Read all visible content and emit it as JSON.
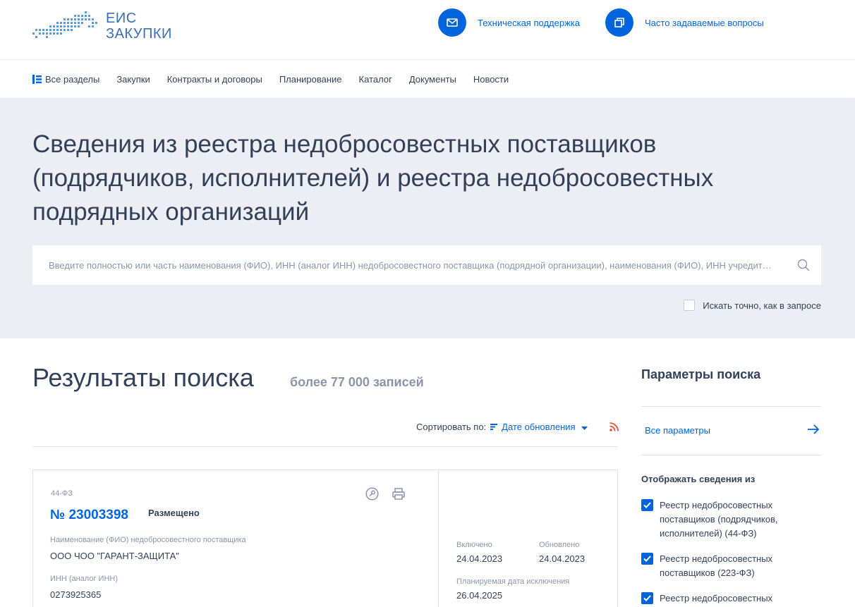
{
  "header": {
    "logo_line1": "ЕИС",
    "logo_line2": "ЗАКУПКИ",
    "support_label": "Техническая поддержка",
    "faq_label": "Часто задаваемые вопросы"
  },
  "nav": {
    "items": [
      {
        "label": "Все разделы"
      },
      {
        "label": "Закупки"
      },
      {
        "label": "Контракты и договоры"
      },
      {
        "label": "Планирование"
      },
      {
        "label": "Каталог"
      },
      {
        "label": "Документы"
      },
      {
        "label": "Новости"
      }
    ]
  },
  "hero": {
    "title": "Сведения из реестра недобросовестных поставщиков (подрядчиков, исполнителей) и реестра недобросовестных подрядных организаций",
    "search_placeholder": "Введите полностью или часть наименования (ФИО), ИНН (аналог ИНН) недобросовестного поставщика (подрядной организации), наименования (ФИО), ИНН учредит…",
    "exact_label": "Искать точно, как в запросе"
  },
  "results": {
    "title": "Результаты поиска",
    "count": "более 77 000 записей",
    "sort_label": "Сортировать по:",
    "sort_value": "Дате обновления"
  },
  "card": {
    "law": "44-ФЗ",
    "number": "№ 23003398",
    "status": "Размещено",
    "name_label": "Наименование (ФИО) недобросовестного поставщика",
    "name_value": "ООО ЧОО \"ГАРАНТ-ЗАЩИТА\"",
    "inn_label": "ИНН (аналог ИНН)",
    "inn_value": "0273925365",
    "included_label": "Включено",
    "included_value": "24.04.2023",
    "updated_label": "Обновлено",
    "updated_value": "24.04.2023",
    "exclusion_label": "Планируемая дата исключения",
    "exclusion_value": "26.04.2025"
  },
  "sidebar": {
    "title": "Параметры поиска",
    "all_params": "Все параметры",
    "show_from": "Отображать сведения из",
    "checks": [
      {
        "label": "Реестр недобросовестных поставщиков (подрядчиков, исполнителей) (44-ФЗ)"
      },
      {
        "label": "Реестр недобросовестных поставщиков (223-ФЗ)"
      },
      {
        "label": "Реестр недобросовестных"
      }
    ]
  },
  "colors": {
    "accent": "#0065dd",
    "text": "#334059",
    "muted": "#8b94a8",
    "hero_bg": "#eceef3",
    "rss": "#e0533a"
  }
}
